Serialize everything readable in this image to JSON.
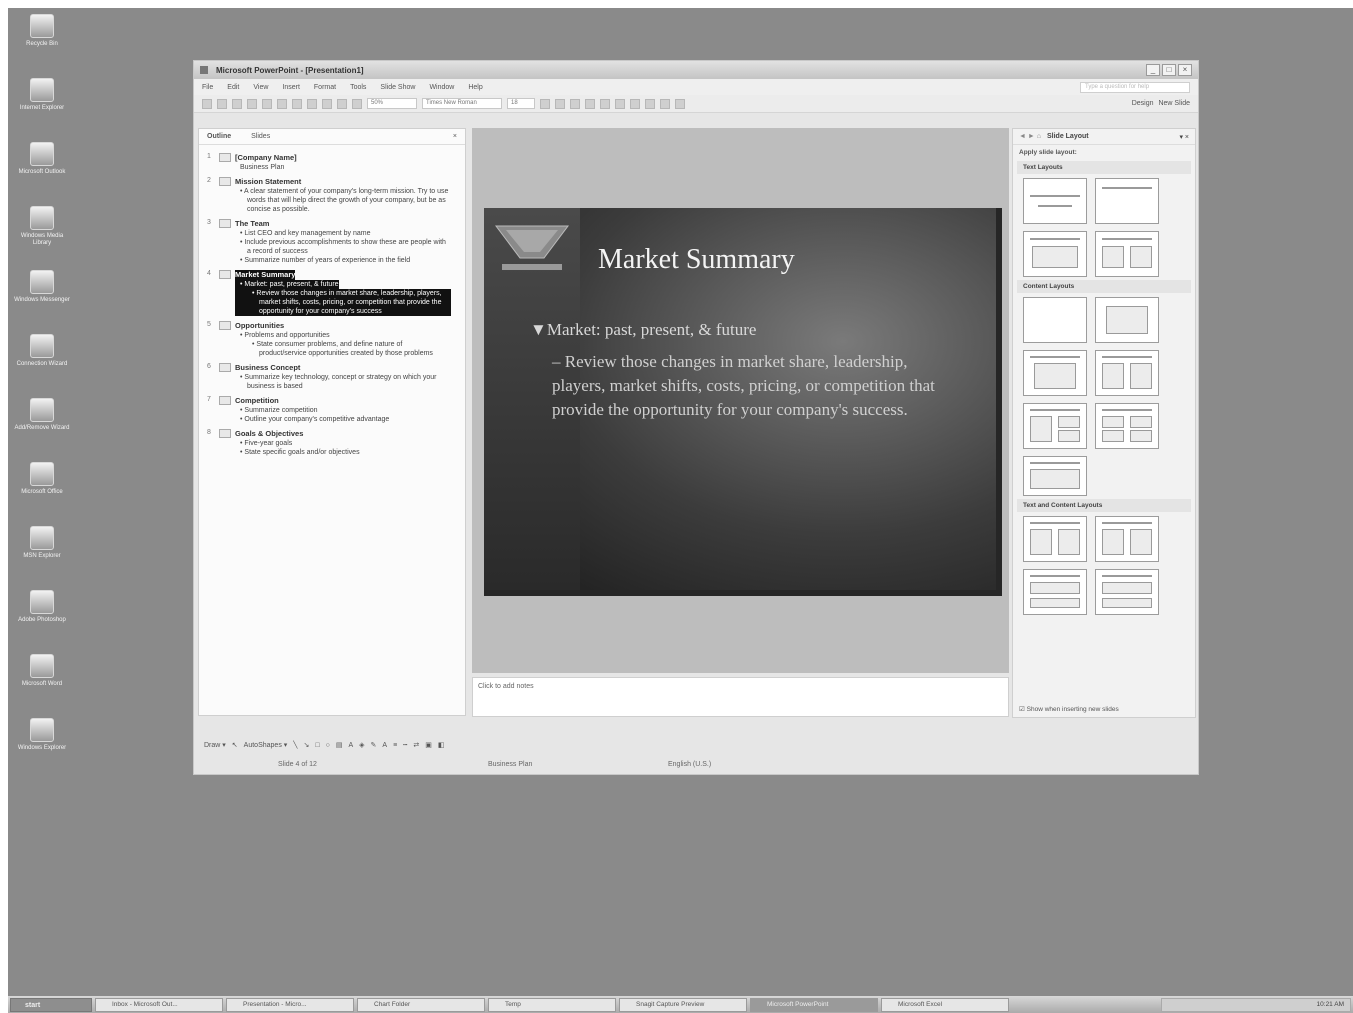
{
  "desktop": {
    "icons": [
      {
        "label": "Recycle Bin",
        "icon": "recycle-bin-icon"
      },
      {
        "label": "Internet Explorer",
        "icon": "internet-explorer-icon"
      },
      {
        "label": "Microsoft Outlook",
        "icon": "outlook-icon"
      },
      {
        "label": "Windows Media Library",
        "icon": "media-library-icon"
      },
      {
        "label": "Windows Messenger",
        "icon": "messenger-icon"
      },
      {
        "label": "Connection Wizard",
        "icon": "connection-wizard-icon"
      },
      {
        "label": "Add/Remove Wizard",
        "icon": "wizard-icon"
      },
      {
        "label": "Microsoft Office",
        "icon": "office-icon"
      },
      {
        "label": "MSN Explorer",
        "icon": "msn-icon"
      },
      {
        "label": "Adobe Photoshop",
        "icon": "photoshop-icon"
      },
      {
        "label": "Microsoft Word",
        "icon": "word-icon"
      },
      {
        "label": "Windows Explorer",
        "icon": "explorer-icon"
      }
    ]
  },
  "window": {
    "title": "Microsoft PowerPoint - [Presentation1]",
    "controls": {
      "minimize": "_",
      "maximize": "□",
      "close": "×"
    }
  },
  "menubar": {
    "items": [
      "File",
      "Edit",
      "View",
      "Insert",
      "Format",
      "Tools",
      "Slide Show",
      "Window",
      "Help"
    ],
    "help_placeholder": "Type a question for help"
  },
  "toolbar": {
    "zoom": "50%",
    "font": "Times New Roman",
    "font_size": "18",
    "design_label": "Design",
    "new_slide_label": "New Slide"
  },
  "outline": {
    "tabs": [
      "Outline",
      "Slides"
    ],
    "close": "×",
    "slides": [
      {
        "num": "1",
        "title": "[Company Name]",
        "bullets": [
          {
            "text": "Business Plan",
            "level": 1
          }
        ]
      },
      {
        "num": "2",
        "title": "Mission Statement",
        "bullets": [
          {
            "text": "• A clear statement of your company's long-term mission. Try to use words that will help direct the growth of your company, but be as concise as possible.",
            "level": 1
          }
        ]
      },
      {
        "num": "3",
        "title": "The Team",
        "bullets": [
          {
            "text": "• List CEO and key management by name",
            "level": 1
          },
          {
            "text": "• Include previous accomplishments to show these are people with a record of success",
            "level": 1
          },
          {
            "text": "• Summarize number of years of experience in the field",
            "level": 1
          }
        ]
      },
      {
        "num": "4",
        "title": "Market Summary",
        "selected": true,
        "bullets": [
          {
            "text": "• Market: past, present, & future",
            "level": 1
          },
          {
            "text": "• Review those changes in market share, leadership, players, market shifts, costs, pricing, or competition that provide the opportunity for your company's success",
            "level": 2
          }
        ]
      },
      {
        "num": "5",
        "title": "Opportunities",
        "bullets": [
          {
            "text": "• Problems and opportunities",
            "level": 1
          },
          {
            "text": "• State consumer problems, and define nature of product/service opportunities created by those problems",
            "level": 2
          }
        ]
      },
      {
        "num": "6",
        "title": "Business Concept",
        "bullets": [
          {
            "text": "• Summarize key technology, concept or strategy on which your business is based",
            "level": 1
          }
        ]
      },
      {
        "num": "7",
        "title": "Competition",
        "bullets": [
          {
            "text": "• Summarize competition",
            "level": 1
          },
          {
            "text": "• Outline your company's competitive advantage",
            "level": 1
          }
        ]
      },
      {
        "num": "8",
        "title": "Goals & Objectives",
        "bullets": [
          {
            "text": "• Five-year goals",
            "level": 1
          },
          {
            "text": "• State specific goals and/or objectives",
            "level": 1
          }
        ]
      }
    ]
  },
  "slide": {
    "title": "Market Summary",
    "bullet1": "Market: past, present, & future",
    "bullet2": "– Review those changes in market share, leadership, players, market shifts, costs, pricing, or competition that provide the opportunity for your company's success."
  },
  "notes": {
    "placeholder": "Click to add notes"
  },
  "taskpane": {
    "title": "Slide Layout",
    "nav": "◄ ► ⌂",
    "apply_label": "Apply slide layout:",
    "sections": [
      "Text Layouts",
      "Content Layouts",
      "Text and Content Layouts"
    ],
    "show_checkbox": "Show when inserting new slides"
  },
  "drawbar": {
    "draw_label": "Draw ▾",
    "autoshapes_label": "AutoShapes ▾"
  },
  "statusbar": {
    "slide": "Slide 4 of 12",
    "design": "Business Plan",
    "language": "English (U.S.)"
  },
  "taskbar": {
    "start": "start",
    "buttons": [
      "Inbox - Microsoft Out...",
      "Presentation - Micro...",
      "Chart Folder",
      "Temp",
      "Snagit Capture Preview",
      "Microsoft PowerPoint",
      "Microsoft Excel"
    ],
    "active_index": 5,
    "clock": "10:21 AM"
  }
}
